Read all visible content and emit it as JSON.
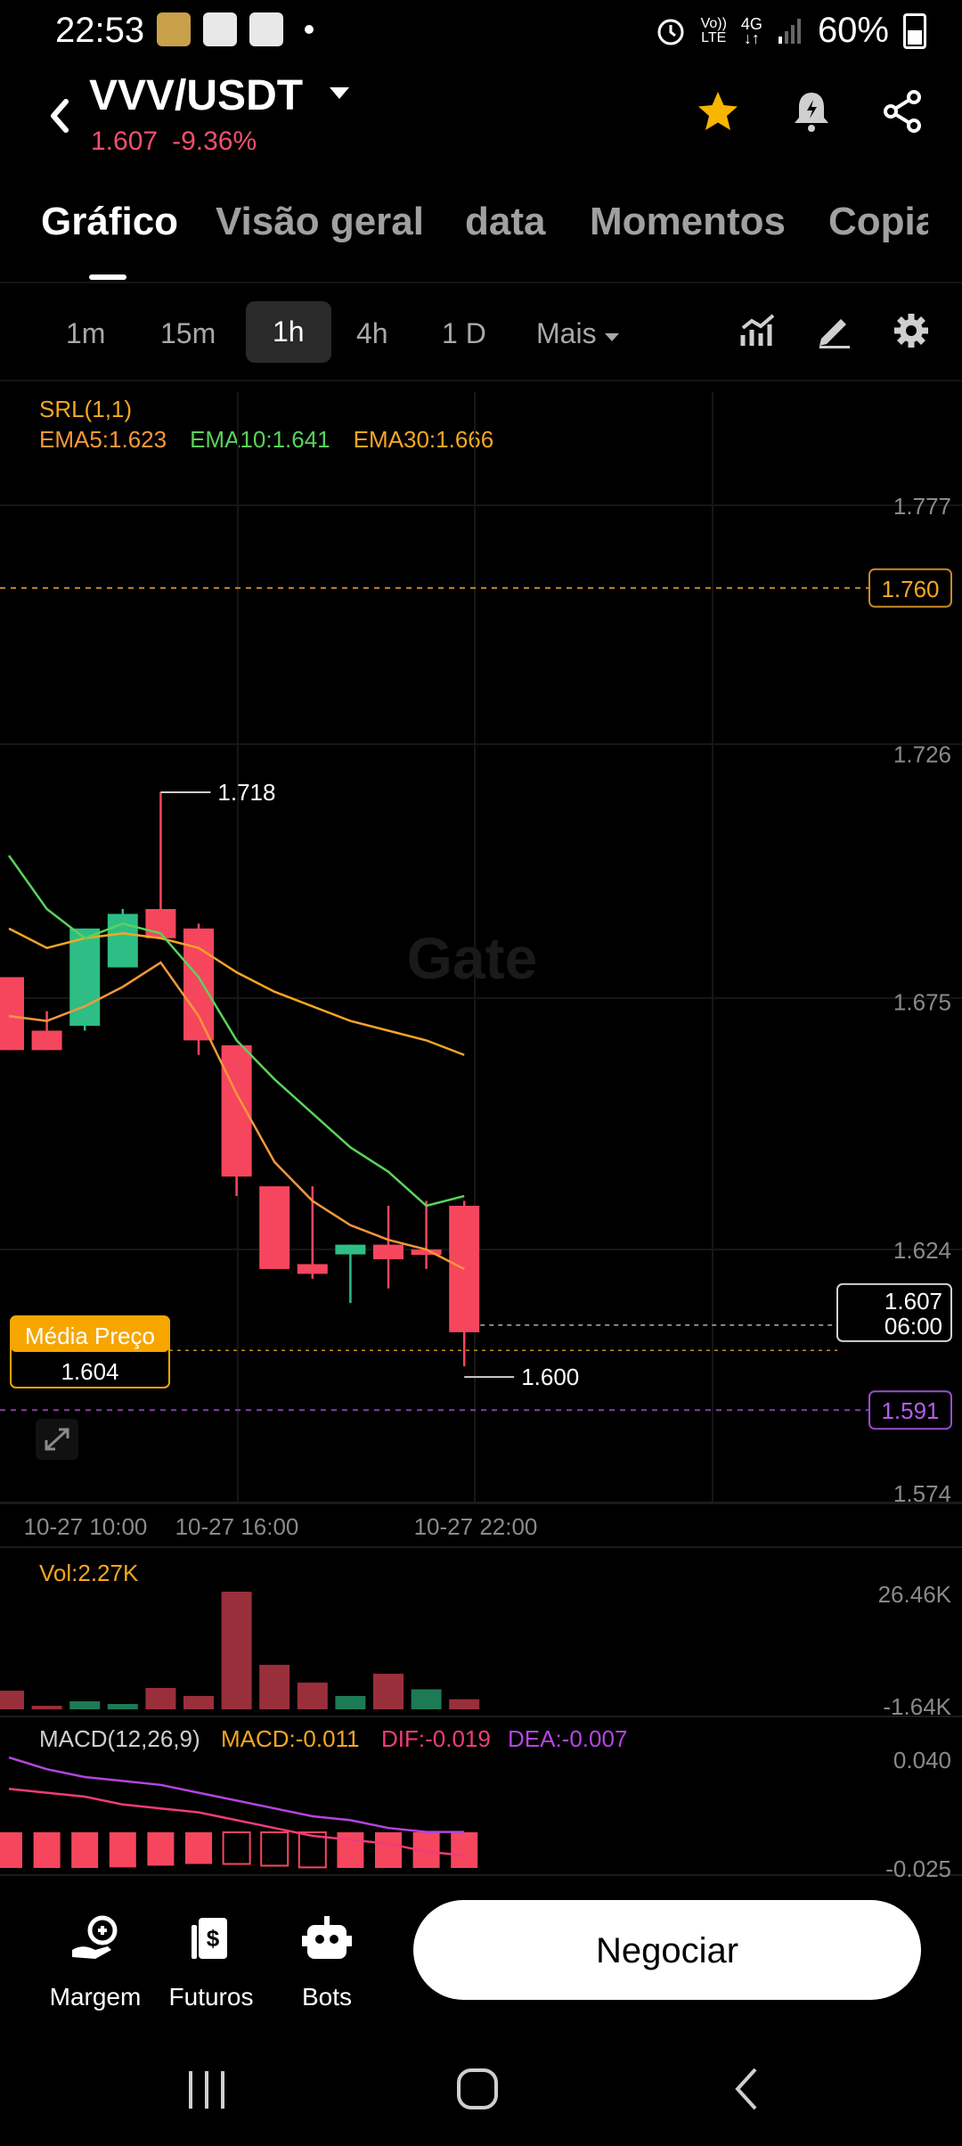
{
  "status_bar": {
    "time": "22:53",
    "network_top": "Vo))",
    "network_bottom": "LTE",
    "net_type": "4G",
    "battery": "60%"
  },
  "header": {
    "pair": "VVV/USDT",
    "price": "1.607",
    "change": "-9.36%"
  },
  "tabs": [
    "Gráfico",
    "Visão geral",
    "data",
    "Momentos",
    "Copia"
  ],
  "intervals": [
    "1m",
    "15m",
    "1h",
    "4h",
    "1 D",
    "Mais"
  ],
  "indicators": {
    "srl": "SRL(1,1)",
    "ema5": "EMA5:1.623",
    "ema10": "EMA10:1.641",
    "ema30": "EMA30:1.666"
  },
  "chart_data": {
    "type": "candlestick",
    "y_ticks": [
      "1.777",
      "1.726",
      "1.675",
      "1.624",
      "1.574"
    ],
    "ylim": [
      1.574,
      1.777
    ],
    "x_ticks": [
      "10-27 10:00",
      "10-27 16:00",
      "10-27 22:00"
    ],
    "candles": [
      {
        "o": 1.68,
        "h": 1.68,
        "l": 1.665,
        "c": 1.665
      },
      {
        "o": 1.669,
        "h": 1.673,
        "l": 1.665,
        "c": 1.665
      },
      {
        "o": 1.67,
        "h": 1.69,
        "l": 1.669,
        "c": 1.69
      },
      {
        "o": 1.682,
        "h": 1.694,
        "l": 1.682,
        "c": 1.693
      },
      {
        "o": 1.694,
        "h": 1.718,
        "l": 1.689,
        "c": 1.688
      },
      {
        "o": 1.69,
        "h": 1.691,
        "l": 1.664,
        "c": 1.667
      },
      {
        "o": 1.666,
        "h": 1.666,
        "l": 1.635,
        "c": 1.639
      },
      {
        "o": 1.637,
        "h": 1.637,
        "l": 1.62,
        "c": 1.62
      },
      {
        "o": 1.621,
        "h": 1.637,
        "l": 1.618,
        "c": 1.619
      },
      {
        "o": 1.623,
        "h": 1.625,
        "l": 1.613,
        "c": 1.625
      },
      {
        "o": 1.625,
        "h": 1.633,
        "l": 1.616,
        "c": 1.622
      },
      {
        "o": 1.624,
        "h": 1.634,
        "l": 1.62,
        "c": 1.623
      },
      {
        "o": 1.633,
        "h": 1.634,
        "l": 1.6,
        "c": 1.607
      }
    ],
    "ema5": [
      1.672,
      1.671,
      1.674,
      1.678,
      1.683,
      1.672,
      1.656,
      1.642,
      1.634,
      1.629,
      1.626,
      1.624,
      1.62
    ],
    "ema10": [
      1.705,
      1.694,
      1.688,
      1.691,
      1.689,
      1.68,
      1.667,
      1.659,
      1.652,
      1.645,
      1.64,
      1.633,
      1.635
    ],
    "ema30": [
      1.69,
      1.686,
      1.688,
      1.689,
      1.688,
      1.686,
      1.681,
      1.677,
      1.674,
      1.671,
      1.669,
      1.667,
      1.664
    ],
    "high_label": "1.718",
    "low_label": "1.600",
    "line_1760": "1.760",
    "line_1591": "1.591",
    "avg_price_label": "Média Preço",
    "avg_price_value": "1.604",
    "current_price": "1.607",
    "countdown": "06:00",
    "volume": {
      "label": "Vol:2.27K",
      "max_label": "26.46K",
      "min_label": "-1.64K",
      "values": [
        4.2,
        0.8,
        1.8,
        1.2,
        4.8,
        3.0,
        26.46,
        10.0,
        6.0,
        3.0,
        8.0,
        4.5,
        2.27
      ],
      "up": [
        false,
        false,
        true,
        true,
        false,
        false,
        false,
        false,
        false,
        true,
        false,
        true,
        false
      ]
    },
    "macd": {
      "label": "MACD(12,26,9)",
      "macd": "MACD:-0.011",
      "dif": "DIF:-0.019",
      "dea": "DEA:-0.007",
      "top_label": "0.040",
      "bottom_label": "-0.025",
      "hist": [
        -0.012,
        -0.014,
        -0.012,
        -0.01,
        -0.009,
        -0.008,
        -0.008,
        -0.009,
        -0.01,
        -0.011,
        -0.012,
        -0.011,
        -0.011
      ],
      "hollow": [
        false,
        false,
        false,
        false,
        false,
        false,
        true,
        true,
        true,
        false,
        false,
        false,
        false
      ],
      "dif_vals": [
        0.0,
        -0.003,
        -0.005,
        -0.006,
        -0.007,
        -0.009,
        -0.011,
        -0.013,
        -0.015,
        -0.016,
        -0.018,
        -0.019,
        -0.019
      ],
      "dea_vals": [
        -0.008,
        -0.009,
        -0.01,
        -0.012,
        -0.013,
        -0.014,
        -0.016,
        -0.018,
        -0.02,
        -0.021,
        -0.022,
        -0.024,
        -0.025
      ]
    },
    "watermark": "Gate"
  },
  "bottom_nav": {
    "margem": "Margem",
    "futuros": "Futuros",
    "bots": "Bots",
    "trade": "Negociar"
  },
  "colors": {
    "up": "#2ebd85",
    "down": "#f6465d",
    "ema5": "#f5983a",
    "ema10": "#5ad35a",
    "ema30": "#f5a623",
    "accent": "#f7a600"
  }
}
